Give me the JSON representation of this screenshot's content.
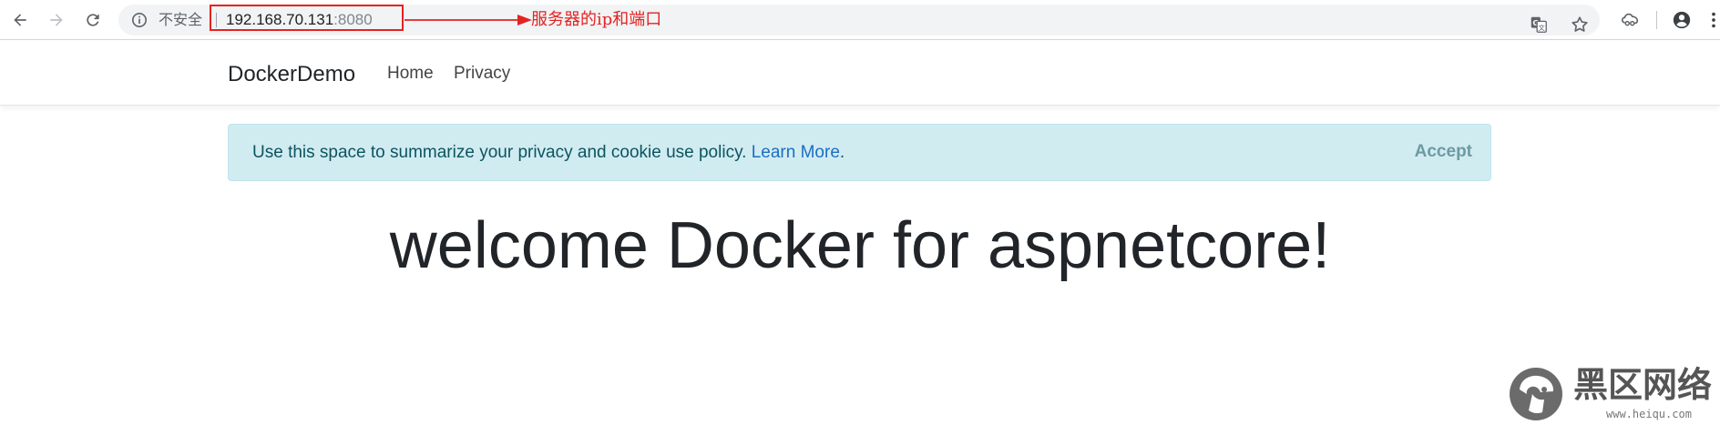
{
  "browser": {
    "security_label": "不安全",
    "url_host": "192.168.70.131",
    "url_port": ":8080"
  },
  "annotation": {
    "text": "服务器的ip和端口",
    "color": "#e52222"
  },
  "icons": {
    "back": "back-arrow-icon",
    "forward": "forward-arrow-icon",
    "reload": "reload-icon",
    "info": "info-icon",
    "translate": "translate-icon",
    "bookmark": "star-icon",
    "extension": "extension-icon",
    "account": "account-icon",
    "menu": "menu-dots-icon"
  },
  "navbar": {
    "brand": "DockerDemo",
    "links": [
      "Home",
      "Privacy"
    ]
  },
  "cookie": {
    "text": "Use this space to summarize your privacy and cookie use policy. ",
    "link_text": "Learn More",
    "after_link": ".",
    "accept_label": "Accept",
    "background": "#d1ecf1"
  },
  "main": {
    "heading": "welcome Docker for aspnetcore!"
  },
  "watermark": {
    "brand_cn": "黑区网络",
    "url": "www.heiqu.com"
  }
}
